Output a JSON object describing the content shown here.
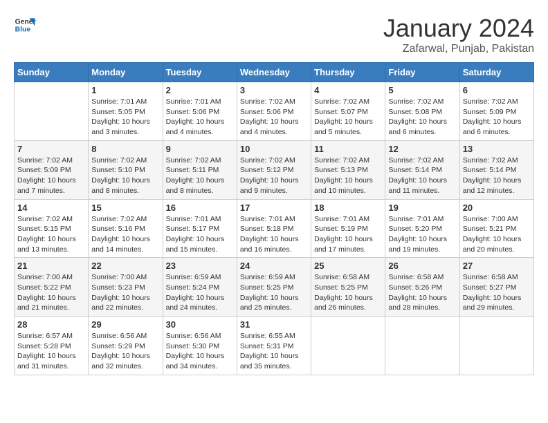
{
  "logo": {
    "line1": "General",
    "line2": "Blue"
  },
  "title": "January 2024",
  "location": "Zafarwal, Punjab, Pakistan",
  "weekdays": [
    "Sunday",
    "Monday",
    "Tuesday",
    "Wednesday",
    "Thursday",
    "Friday",
    "Saturday"
  ],
  "weeks": [
    [
      {
        "day": "",
        "sunrise": "",
        "sunset": "",
        "daylight": ""
      },
      {
        "day": "1",
        "sunrise": "Sunrise: 7:01 AM",
        "sunset": "Sunset: 5:05 PM",
        "daylight": "Daylight: 10 hours and 3 minutes."
      },
      {
        "day": "2",
        "sunrise": "Sunrise: 7:01 AM",
        "sunset": "Sunset: 5:06 PM",
        "daylight": "Daylight: 10 hours and 4 minutes."
      },
      {
        "day": "3",
        "sunrise": "Sunrise: 7:02 AM",
        "sunset": "Sunset: 5:06 PM",
        "daylight": "Daylight: 10 hours and 4 minutes."
      },
      {
        "day": "4",
        "sunrise": "Sunrise: 7:02 AM",
        "sunset": "Sunset: 5:07 PM",
        "daylight": "Daylight: 10 hours and 5 minutes."
      },
      {
        "day": "5",
        "sunrise": "Sunrise: 7:02 AM",
        "sunset": "Sunset: 5:08 PM",
        "daylight": "Daylight: 10 hours and 6 minutes."
      },
      {
        "day": "6",
        "sunrise": "Sunrise: 7:02 AM",
        "sunset": "Sunset: 5:09 PM",
        "daylight": "Daylight: 10 hours and 6 minutes."
      }
    ],
    [
      {
        "day": "7",
        "sunrise": "Sunrise: 7:02 AM",
        "sunset": "Sunset: 5:09 PM",
        "daylight": "Daylight: 10 hours and 7 minutes."
      },
      {
        "day": "8",
        "sunrise": "Sunrise: 7:02 AM",
        "sunset": "Sunset: 5:10 PM",
        "daylight": "Daylight: 10 hours and 8 minutes."
      },
      {
        "day": "9",
        "sunrise": "Sunrise: 7:02 AM",
        "sunset": "Sunset: 5:11 PM",
        "daylight": "Daylight: 10 hours and 8 minutes."
      },
      {
        "day": "10",
        "sunrise": "Sunrise: 7:02 AM",
        "sunset": "Sunset: 5:12 PM",
        "daylight": "Daylight: 10 hours and 9 minutes."
      },
      {
        "day": "11",
        "sunrise": "Sunrise: 7:02 AM",
        "sunset": "Sunset: 5:13 PM",
        "daylight": "Daylight: 10 hours and 10 minutes."
      },
      {
        "day": "12",
        "sunrise": "Sunrise: 7:02 AM",
        "sunset": "Sunset: 5:14 PM",
        "daylight": "Daylight: 10 hours and 11 minutes."
      },
      {
        "day": "13",
        "sunrise": "Sunrise: 7:02 AM",
        "sunset": "Sunset: 5:14 PM",
        "daylight": "Daylight: 10 hours and 12 minutes."
      }
    ],
    [
      {
        "day": "14",
        "sunrise": "Sunrise: 7:02 AM",
        "sunset": "Sunset: 5:15 PM",
        "daylight": "Daylight: 10 hours and 13 minutes."
      },
      {
        "day": "15",
        "sunrise": "Sunrise: 7:02 AM",
        "sunset": "Sunset: 5:16 PM",
        "daylight": "Daylight: 10 hours and 14 minutes."
      },
      {
        "day": "16",
        "sunrise": "Sunrise: 7:01 AM",
        "sunset": "Sunset: 5:17 PM",
        "daylight": "Daylight: 10 hours and 15 minutes."
      },
      {
        "day": "17",
        "sunrise": "Sunrise: 7:01 AM",
        "sunset": "Sunset: 5:18 PM",
        "daylight": "Daylight: 10 hours and 16 minutes."
      },
      {
        "day": "18",
        "sunrise": "Sunrise: 7:01 AM",
        "sunset": "Sunset: 5:19 PM",
        "daylight": "Daylight: 10 hours and 17 minutes."
      },
      {
        "day": "19",
        "sunrise": "Sunrise: 7:01 AM",
        "sunset": "Sunset: 5:20 PM",
        "daylight": "Daylight: 10 hours and 19 minutes."
      },
      {
        "day": "20",
        "sunrise": "Sunrise: 7:00 AM",
        "sunset": "Sunset: 5:21 PM",
        "daylight": "Daylight: 10 hours and 20 minutes."
      }
    ],
    [
      {
        "day": "21",
        "sunrise": "Sunrise: 7:00 AM",
        "sunset": "Sunset: 5:22 PM",
        "daylight": "Daylight: 10 hours and 21 minutes."
      },
      {
        "day": "22",
        "sunrise": "Sunrise: 7:00 AM",
        "sunset": "Sunset: 5:23 PM",
        "daylight": "Daylight: 10 hours and 22 minutes."
      },
      {
        "day": "23",
        "sunrise": "Sunrise: 6:59 AM",
        "sunset": "Sunset: 5:24 PM",
        "daylight": "Daylight: 10 hours and 24 minutes."
      },
      {
        "day": "24",
        "sunrise": "Sunrise: 6:59 AM",
        "sunset": "Sunset: 5:25 PM",
        "daylight": "Daylight: 10 hours and 25 minutes."
      },
      {
        "day": "25",
        "sunrise": "Sunrise: 6:58 AM",
        "sunset": "Sunset: 5:25 PM",
        "daylight": "Daylight: 10 hours and 26 minutes."
      },
      {
        "day": "26",
        "sunrise": "Sunrise: 6:58 AM",
        "sunset": "Sunset: 5:26 PM",
        "daylight": "Daylight: 10 hours and 28 minutes."
      },
      {
        "day": "27",
        "sunrise": "Sunrise: 6:58 AM",
        "sunset": "Sunset: 5:27 PM",
        "daylight": "Daylight: 10 hours and 29 minutes."
      }
    ],
    [
      {
        "day": "28",
        "sunrise": "Sunrise: 6:57 AM",
        "sunset": "Sunset: 5:28 PM",
        "daylight": "Daylight: 10 hours and 31 minutes."
      },
      {
        "day": "29",
        "sunrise": "Sunrise: 6:56 AM",
        "sunset": "Sunset: 5:29 PM",
        "daylight": "Daylight: 10 hours and 32 minutes."
      },
      {
        "day": "30",
        "sunrise": "Sunrise: 6:56 AM",
        "sunset": "Sunset: 5:30 PM",
        "daylight": "Daylight: 10 hours and 34 minutes."
      },
      {
        "day": "31",
        "sunrise": "Sunrise: 6:55 AM",
        "sunset": "Sunset: 5:31 PM",
        "daylight": "Daylight: 10 hours and 35 minutes."
      },
      {
        "day": "",
        "sunrise": "",
        "sunset": "",
        "daylight": ""
      },
      {
        "day": "",
        "sunrise": "",
        "sunset": "",
        "daylight": ""
      },
      {
        "day": "",
        "sunrise": "",
        "sunset": "",
        "daylight": ""
      }
    ]
  ]
}
